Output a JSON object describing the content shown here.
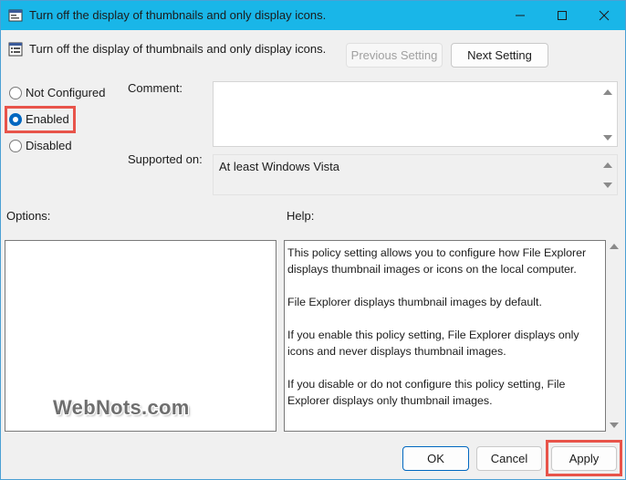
{
  "window": {
    "title": "Turn off the display of thumbnails and only display icons."
  },
  "header": {
    "policy_name": "Turn off the display of thumbnails and only display icons.",
    "previous_label": "Previous Setting",
    "next_label": "Next Setting"
  },
  "state": {
    "not_configured_label": "Not Configured",
    "enabled_label": "Enabled",
    "disabled_label": "Disabled",
    "selected": "Enabled"
  },
  "comment": {
    "label": "Comment:",
    "value": ""
  },
  "supported": {
    "label": "Supported on:",
    "value": "At least Windows Vista"
  },
  "options": {
    "label": "Options:"
  },
  "help": {
    "label": "Help:",
    "paragraphs": [
      "This policy setting allows you to configure how File Explorer displays thumbnail images or icons on the local computer.",
      "File Explorer displays thumbnail images by default.",
      "If you enable this policy setting, File Explorer displays only icons and never displays thumbnail images.",
      "If you disable or do not configure this policy setting, File Explorer displays only thumbnail images."
    ]
  },
  "footer": {
    "ok_label": "OK",
    "cancel_label": "Cancel",
    "apply_label": "Apply"
  },
  "watermark": "WebNots.com",
  "colors": {
    "titlebar": "#19b6e8",
    "accent": "#0067c0",
    "highlight": "#e8544a"
  },
  "icons": [
    "policy-icon",
    "minimize-icon",
    "maximize-icon",
    "close-icon",
    "scroll-up-icon",
    "scroll-down-icon"
  ]
}
